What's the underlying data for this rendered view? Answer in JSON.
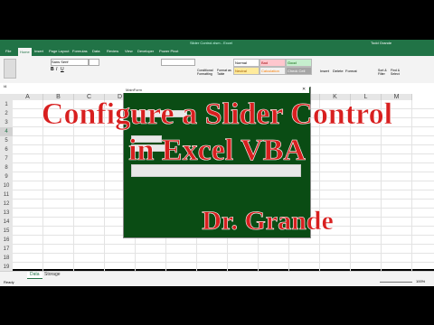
{
  "title_line1": "Configure a Slider Control",
  "title_line2": "in Excel VBA",
  "author": "Dr. Grande",
  "window_title": "Slider Control.xlsm - Excel",
  "user_name": "Todd Grande",
  "ribbon_tabs": [
    "File",
    "Home",
    "Insert",
    "Page Layout",
    "Formulas",
    "Data",
    "Review",
    "View",
    "Developer",
    "Power Pivot"
  ],
  "font_name": "Sans Serif",
  "cell_styles": {
    "normal": "Normal",
    "bad": "Bad",
    "good": "Good",
    "neutral": "Neutral",
    "calculation": "Calculation",
    "check_cell": "Check Cell"
  },
  "groups": {
    "conditional": "Conditional Formatting",
    "format_as": "Format as Table",
    "insert": "Insert",
    "delete": "Delete",
    "format": "Format",
    "sort": "Sort & Filter",
    "find": "Find & Select"
  },
  "namebox": "I4",
  "column_headers": [
    "A",
    "B",
    "C",
    "D",
    "E",
    "F",
    "G",
    "H",
    "I",
    "J",
    "K",
    "L",
    "M"
  ],
  "row_numbers": [
    "1",
    "2",
    "3",
    "4",
    "5",
    "6",
    "7",
    "8",
    "9",
    "10",
    "11",
    "12",
    "13",
    "14",
    "15",
    "16",
    "17",
    "18",
    "19"
  ],
  "form_title": "MainForm",
  "sheet_tabs": [
    "Data",
    "Storage"
  ],
  "status_text": "Ready",
  "zoom": "100%",
  "colors": {
    "excel_green": "#217346",
    "form_bg": "#0a4c14",
    "title_red": "#d81f1f"
  }
}
